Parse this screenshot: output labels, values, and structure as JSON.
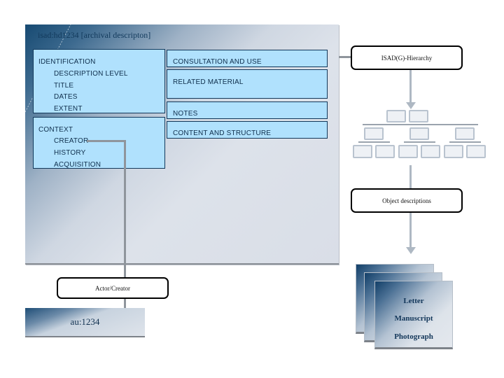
{
  "archival_description": {
    "title": "isad:hd1234 [archival descripton]",
    "identification": {
      "heading": "IDENTIFICATION",
      "items": [
        "DESCRIPTION LEVEL",
        "TITLE",
        "DATES",
        "EXTENT"
      ]
    },
    "context": {
      "heading": "CONTEXT",
      "items": [
        "CREATOR",
        "HISTORY",
        "ACQUISITION"
      ]
    },
    "right_sections": [
      "CONSULTATION AND USE",
      "RELATED MATERIAL",
      "NOTES",
      "CONTENT AND STRUCTURE"
    ]
  },
  "hierarchy": {
    "label": "ISAD(G)-Hierarchy"
  },
  "object_descriptions": {
    "label": "Object descriptions",
    "items": [
      "Letter",
      "Manuscript",
      "Photograph"
    ]
  },
  "actor": {
    "label": "Actor/Creator",
    "record_id": "au:1234"
  },
  "colors": {
    "field_box": "#b0e1fd",
    "border_dark": "#12385a",
    "accent_navy": "#174a72"
  }
}
